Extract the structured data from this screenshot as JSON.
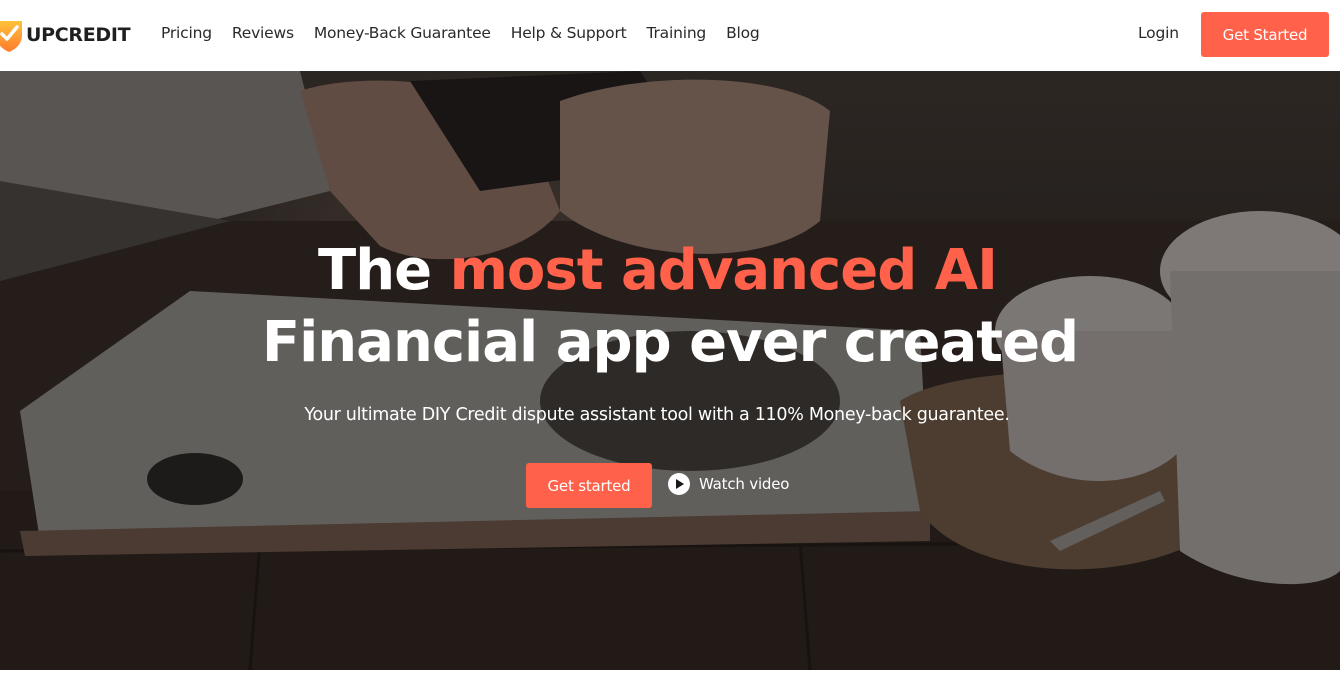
{
  "brand": {
    "name": "UPCREDIT",
    "accent_color": "#ff614a",
    "logo_icon": "shield-check-logo-icon"
  },
  "nav": {
    "items": [
      {
        "label": "Pricing"
      },
      {
        "label": "Reviews"
      },
      {
        "label": "Money-Back Guarantee"
      },
      {
        "label": "Help & Support"
      },
      {
        "label": "Training"
      },
      {
        "label": "Blog"
      }
    ],
    "login_label": "Login",
    "get_started_label": "Get Started"
  },
  "hero": {
    "headline_prefix": "The ",
    "headline_accent": "most advanced AI",
    "headline_line2": "Financial app ever created",
    "subtitle": "Your ultimate DIY Credit dispute assistant tool with a 110% Money-back guarantee.",
    "cta_label": "Get started",
    "watch_label": "Watch video",
    "watch_icon": "play-icon"
  }
}
